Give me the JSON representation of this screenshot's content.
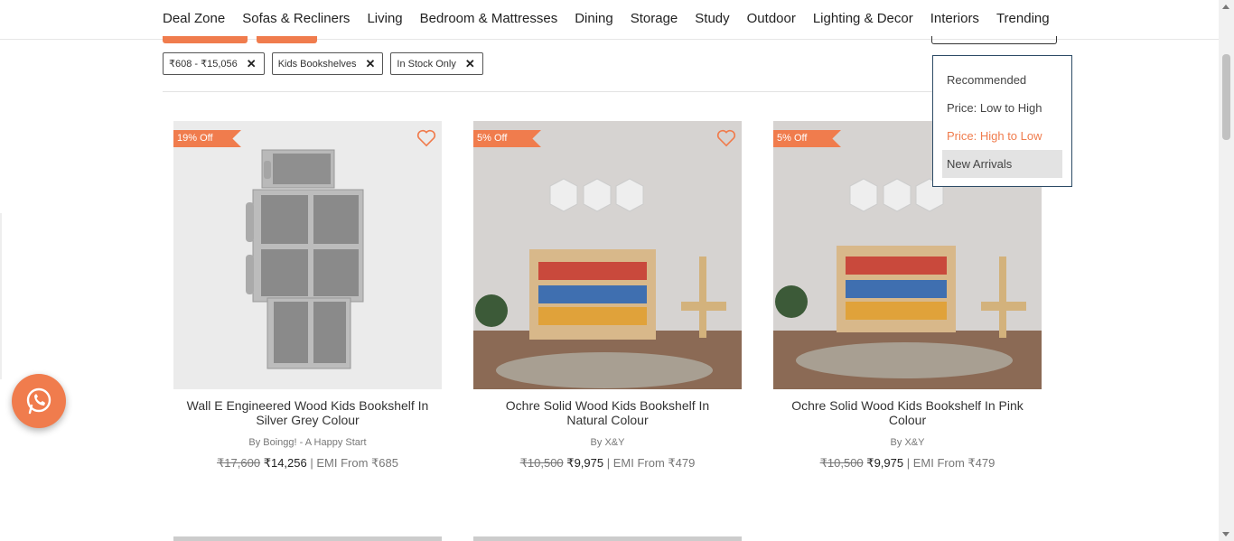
{
  "nav": {
    "items": [
      "Deal Zone",
      "Sofas & Recliners",
      "Living",
      "Bedroom & Mattresses",
      "Dining",
      "Storage",
      "Study",
      "Outdoor",
      "Lighting & Decor",
      "Interiors",
      "Trending"
    ]
  },
  "filters": {
    "chips": [
      {
        "label": "₹608 - ₹15,056"
      },
      {
        "label": "Kids Bookshelves"
      },
      {
        "label": "In Stock Only"
      }
    ],
    "remove_glyph": "✕"
  },
  "sort": {
    "options": [
      "Recommended",
      "Price: Low to High",
      "Price: High to Low",
      "New Arrivals"
    ],
    "active": "Price: High to Low",
    "hovered": "New Arrivals"
  },
  "products": [
    {
      "discount": "19% Off",
      "name": "Wall E Engineered Wood Kids Bookshelf In Silver Grey Colour",
      "brand": "By Boingg! - A Happy Start",
      "mrp": "₹17,600",
      "price": "₹14,256",
      "emi": "| EMI From ₹685"
    },
    {
      "discount": "5% Off",
      "name": "Ochre Solid Wood Kids Bookshelf In Natural Colour",
      "brand": "By X&Y",
      "mrp": "₹10,500",
      "price": "₹9,975",
      "emi": "| EMI From ₹479"
    },
    {
      "discount": "5% Off",
      "name": "Ochre Solid Wood Kids Bookshelf In Pink Colour",
      "brand": "By X&Y",
      "mrp": "₹10,500",
      "price": "₹9,975",
      "emi": "| EMI From ₹479"
    }
  ],
  "icons": {
    "wishlist": "heart-icon",
    "whatsapp": "whatsapp-icon",
    "remove": "close-icon"
  },
  "colors": {
    "accent": "#f07c4d",
    "dropdown_border": "#2d4b66"
  }
}
